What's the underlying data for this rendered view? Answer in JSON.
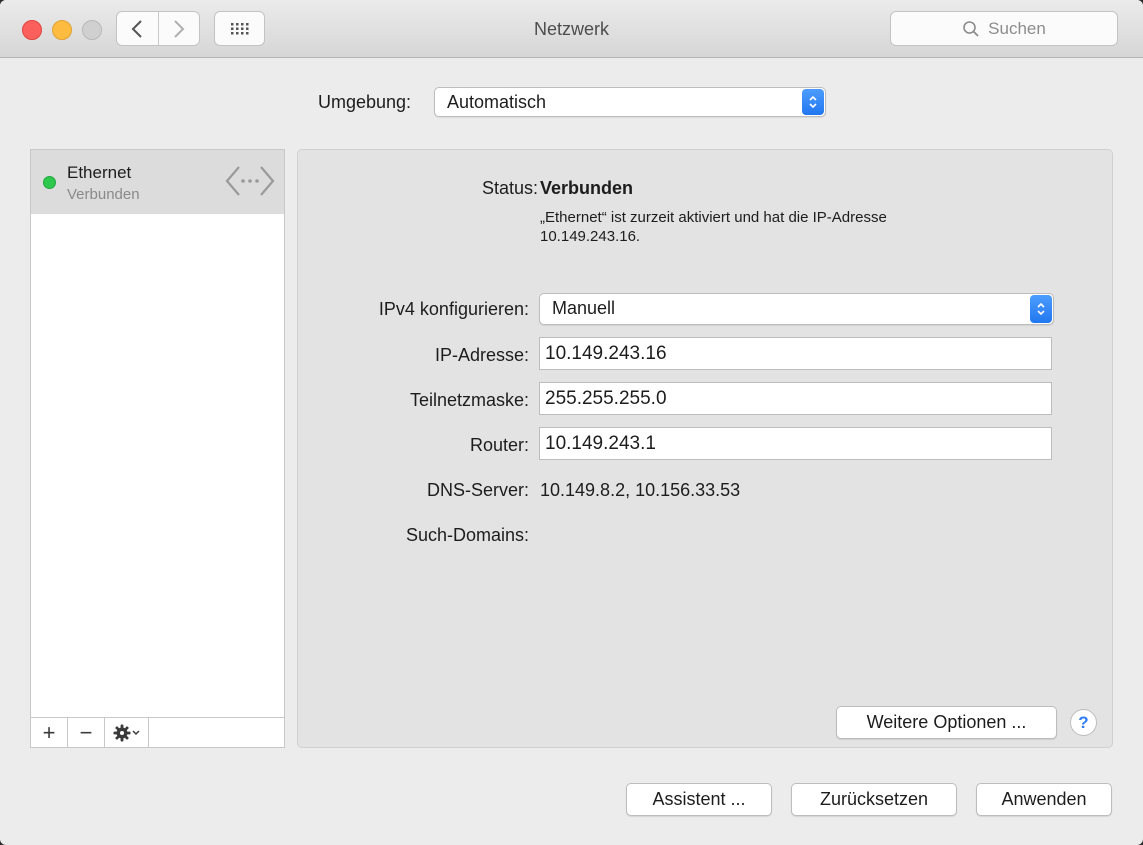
{
  "window": {
    "title": "Netzwerk"
  },
  "toolbar": {
    "search_placeholder": "Suchen"
  },
  "location": {
    "label": "Umgebung:",
    "value": "Automatisch"
  },
  "sidebar": {
    "services": [
      {
        "name": "Ethernet",
        "status": "Verbunden",
        "status_color": "#2dc84d"
      }
    ],
    "add_label": "+",
    "remove_label": "−"
  },
  "detail": {
    "status_label": "Status:",
    "status_value": "Verbunden",
    "status_description_line1": "„Ethernet“ ist zurzeit aktiviert und hat die IP-Adresse",
    "status_description_line2": "10.149.243.16.",
    "ipv4_label": "IPv4 konfigurieren:",
    "ipv4_value": "Manuell",
    "ip_label": "IP-Adresse:",
    "ip_value": "10.149.243.16",
    "subnet_label": "Teilnetzmaske:",
    "subnet_value": "255.255.255.0",
    "router_label": "Router:",
    "router_value": "10.149.243.1",
    "dns_label": "DNS-Server:",
    "dns_value": "10.149.8.2, 10.156.33.53",
    "search_domains_label": "Such-Domains:",
    "more_options_label": "Weitere Optionen ...",
    "help_label": "?"
  },
  "footer": {
    "assistant_label": "Assistent ...",
    "reset_label": "Zurücksetzen",
    "apply_label": "Anwenden"
  },
  "colors": {
    "accent": "#2177ef",
    "connected": "#2dc84d"
  }
}
